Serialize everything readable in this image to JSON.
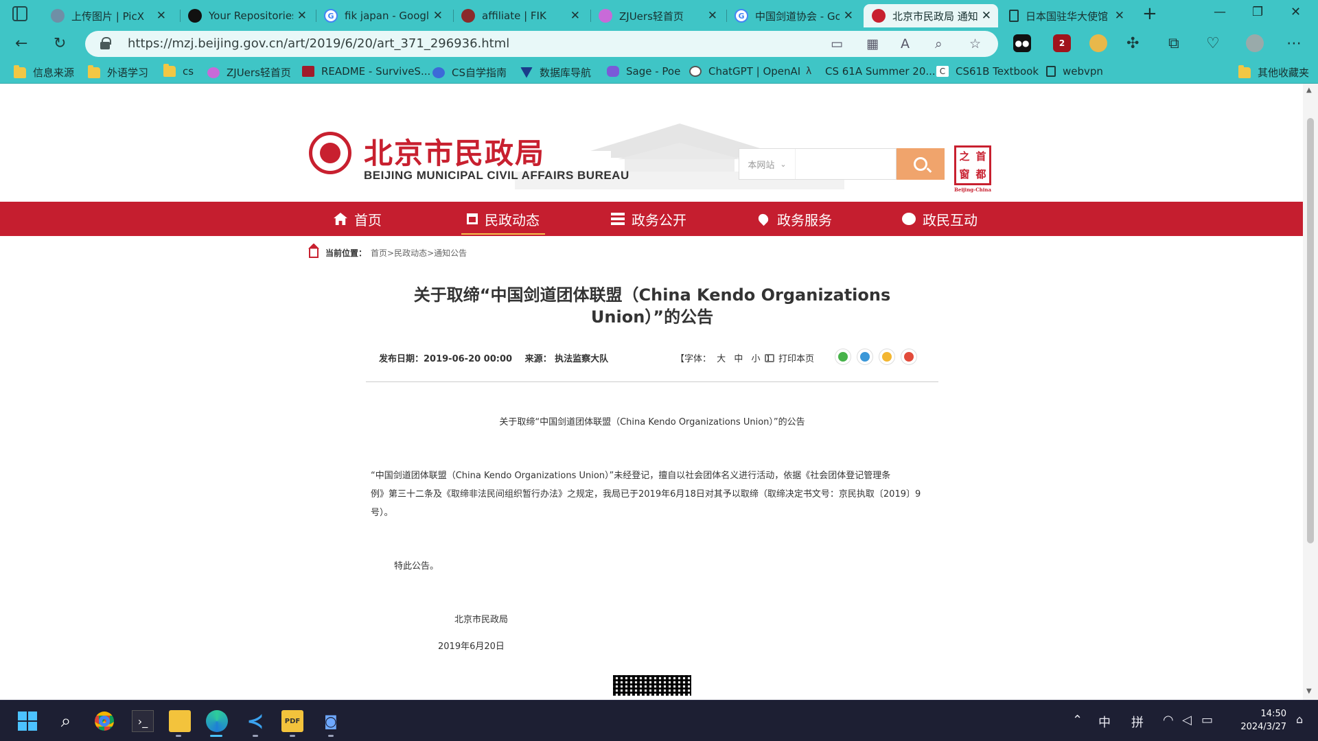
{
  "browser": {
    "tabs": [
      {
        "title": "上传图片 | PicX",
        "icon": "picx-icon",
        "color": "#6f8fa6"
      },
      {
        "title": "Your Repositories",
        "icon": "github-icon",
        "color": "#111111"
      },
      {
        "title": "fik japan - Google",
        "icon": "google-icon",
        "color": "#4285f4"
      },
      {
        "title": "affiliate | FIK",
        "icon": "fik-icon",
        "color": "#8a2a2a"
      },
      {
        "title": "ZJUers轻首页",
        "icon": "zjuers-icon",
        "color": "#c86ad8"
      },
      {
        "title": "中国剑道协会 - Go",
        "icon": "google-icon",
        "color": "#4285f4"
      },
      {
        "title": "北京市民政局 通知",
        "icon": "bureau-icon",
        "color": "#c8202f",
        "active": true
      },
      {
        "title": "日本国驻华大使馆",
        "icon": "page-icon",
        "color": "#1b3b3b"
      }
    ],
    "url": "https://mzj.beijing.gov.cn/art/2019/6/20/art_371_296936.html",
    "bookmarks": [
      {
        "label": "信息来源",
        "icon": "folder-icon"
      },
      {
        "label": "外语学习",
        "icon": "folder-icon"
      },
      {
        "label": "cs",
        "icon": "folder-icon"
      },
      {
        "label": "ZJUers轻首页",
        "icon": "zjuers-icon"
      },
      {
        "label": "README - SurviveS...",
        "icon": "readme-icon"
      },
      {
        "label": "CS自学指南",
        "icon": "cs-icon"
      },
      {
        "label": "数据库导航",
        "icon": "db-icon"
      },
      {
        "label": "Sage - Poe",
        "icon": "poe-icon"
      },
      {
        "label": "ChatGPT | OpenAI",
        "icon": "openai-icon"
      },
      {
        "label": "CS 61A Summer 20...",
        "icon": "cs61a-icon"
      },
      {
        "label": "CS61B Textbook",
        "icon": "cs61b-icon"
      },
      {
        "label": "webvpn",
        "icon": "page-icon"
      }
    ],
    "other_bookmarks": "其他收藏夹",
    "badge_count": "2"
  },
  "site": {
    "name_cn": "北京市民政局",
    "name_en": "BEIJING MUNICIPAL CIVIL AFFAIRS BUREAU",
    "search_scope": "本网站",
    "search_placeholder": "",
    "seal_chars": [
      "首",
      "都",
      "之",
      "窗"
    ],
    "seal_caption": "Beijing-China",
    "brand_color": "#c51e2f",
    "nav": [
      {
        "label": "首页",
        "icon": "home-icon"
      },
      {
        "label": "民政动态",
        "icon": "building-icon",
        "active": true
      },
      {
        "label": "政务公开",
        "icon": "list-icon"
      },
      {
        "label": "政务服务",
        "icon": "heart-icon"
      },
      {
        "label": "政民互动",
        "icon": "chat-icon"
      }
    ],
    "breadcrumb": {
      "label": "当前位置：",
      "path": "首页>民政动态>通知公告"
    }
  },
  "article": {
    "title": "关于取缔“中国剑道团体联盟（China Kendo Organizations Union）”的公告",
    "date": "发布日期：2019-06-20 00:00",
    "source": "来源：  执法监察大队",
    "font_label": "【字体：",
    "font_sizes": [
      "大",
      "中",
      "小"
    ],
    "font_close": "】",
    "print_label": "打印本页",
    "share": [
      {
        "icon": "wechat-icon",
        "color": "#47b34a"
      },
      {
        "icon": "qq-icon",
        "color": "#3a97d8"
      },
      {
        "icon": "qzone-icon",
        "color": "#f3b631"
      },
      {
        "icon": "weibo-icon",
        "color": "#e24b3b"
      }
    ],
    "heading_repeat": "关于取缔“中国剑道团体联盟（China Kendo Organizations Union）”的公告",
    "body_line1": "“中国剑道团体联盟（China Kendo Organizations Union）”未经登记，擅自以社会团体名义进行活动，依据《社会团体登记管理条",
    "body_line2": "例》第三十二条及《取缔非法民间组织暂行办法》之规定，我局已于2019年6月18日对其予以取缔（取缔决定书文号：京民执取〔2019〕9",
    "body_line3": "号）。",
    "closing": "特此公告。",
    "signature": "北京市民政局",
    "sign_date": "2019年6月20日"
  },
  "taskbar": {
    "apps": [
      "start-icon",
      "search-icon",
      "chrome-icon",
      "terminal-icon",
      "explorer-icon",
      "edge-icon",
      "vscode-icon",
      "pdf-icon",
      "app-icon"
    ],
    "ime_lang": "中",
    "ime_mode": "拼",
    "time": "14:50",
    "date": "2024/3/27"
  }
}
